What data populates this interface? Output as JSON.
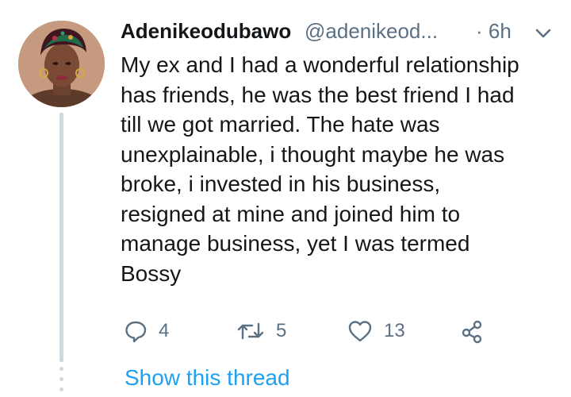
{
  "tweet": {
    "display_name": "Adenikeodubawo",
    "handle": "@adenikeod...",
    "time": "· 6h",
    "avatar_icon": "user-avatar-photo",
    "more_icon": "chevron-down-icon",
    "text_lines": [
      "My ex and I had a wonderful relationship",
      "has friends, he was the best friend I had",
      "till we got married. The hate was",
      "unexplainable, i thought maybe he was",
      "broke, i invested in his business,",
      "resigned at mine and joined him to",
      "manage business, yet I was termed",
      "Bossy"
    ],
    "actions": {
      "reply_count": "4",
      "retweet_count": "5",
      "like_count": "13"
    },
    "show_thread_label": "Show this thread"
  },
  "colors": {
    "text": "#14171a",
    "secondary": "#5b7083",
    "accent": "#1da1f2",
    "thread_line": "#cfd9de"
  }
}
